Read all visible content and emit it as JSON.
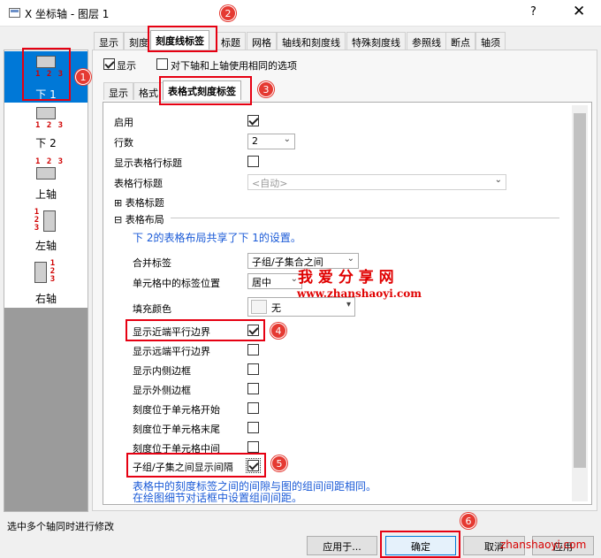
{
  "window": {
    "title": "X 坐标轴 - 图层 1",
    "help": "?",
    "close": "✕"
  },
  "axis_list": [
    {
      "ticks": "1 2 3",
      "label": "下 1",
      "selected": true
    },
    {
      "ticks": "1 2 3",
      "label": "下 2",
      "selected": false
    },
    {
      "ticks": "1 2 3",
      "label": "上轴",
      "selected": false
    },
    {
      "ticks": "1 2 3",
      "label": "左轴",
      "selected": false
    },
    {
      "ticks": "1 2 3",
      "label": "右轴",
      "selected": false
    }
  ],
  "main_tabs": [
    "显示",
    "刻度",
    "刻度线标签",
    "标题",
    "网格",
    "轴线和刻度线",
    "特殊刻度线",
    "参照线",
    "断点",
    "轴须"
  ],
  "top_options": {
    "show": "显示",
    "same_as_bottom": "对下轴和上轴使用相同的选项"
  },
  "sub_tabs": [
    "显示",
    "格式",
    "表格式刻度标签"
  ],
  "props": {
    "enable": "启用",
    "rows": "行数",
    "rows_value": "2",
    "show_row_title": "显示表格行标题",
    "row_title": "表格行标题",
    "row_title_value": "<自动>",
    "table_title": "表格标题",
    "table_layout": "表格布局",
    "shared_note": "下 2的表格布局共享了下 1的设置。",
    "merge_labels": "合并标签",
    "merge_labels_value": "子组/子集合之间",
    "label_pos": "单元格中的标签位置",
    "label_pos_value": "居中",
    "fill_color": "填充颜色",
    "fill_color_value": "无",
    "near_border": "显示近端平行边界",
    "far_border": "显示远端平行边界",
    "inner_border": "显示内侧边框",
    "outer_border": "显示外侧边框",
    "tick_start": "刻度位于单元格开始",
    "tick_end": "刻度位于单元格末尾",
    "tick_middle": "刻度位于单元格中间",
    "gap_between": "子组/子集之间显示间隔",
    "gap_note_1": "表格中的刻度标签之间的间隙与图的组间间距相同。",
    "gap_note_2": "在绘图细节对话框中设置组间间距。"
  },
  "status_text": "选中多个轴同时进行修改",
  "buttons": {
    "apply_to": "应用于...",
    "ok": "确定",
    "cancel": "取消",
    "apply": "应用"
  },
  "watermark": {
    "name": "我 爱 分 享 网",
    "url": "www.zhanshaoyi.com",
    "corner": "zhanshaoyi.com"
  },
  "badges": [
    "1",
    "2",
    "3",
    "4",
    "5",
    "6"
  ],
  "colors": {
    "selection": "#0078d7",
    "annotation": "#e60012",
    "note_text": "#1a5ad7"
  }
}
